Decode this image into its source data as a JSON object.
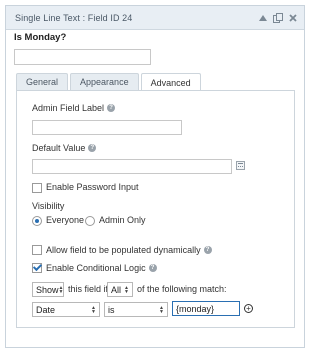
{
  "window": {
    "title": "Single Line Text : Field ID 24",
    "controls": [
      "collapse-up-icon",
      "duplicate-icon",
      "close-icon"
    ]
  },
  "field": {
    "label": "Is Monday?",
    "preview_value": ""
  },
  "tabs": [
    {
      "label": "General",
      "active": false
    },
    {
      "label": "Appearance",
      "active": false
    },
    {
      "label": "Advanced",
      "active": true
    }
  ],
  "advanced": {
    "admin_label": {
      "label": "Admin Field Label",
      "value": ""
    },
    "default_value": {
      "label": "Default Value",
      "value": ""
    },
    "password": {
      "label": "Enable Password Input",
      "checked": false
    },
    "visibility": {
      "label": "Visibility",
      "options": [
        {
          "label": "Everyone",
          "selected": true
        },
        {
          "label": "Admin Only",
          "selected": false
        }
      ]
    },
    "dynamic": {
      "label": "Allow field to be populated dynamically",
      "checked": false
    },
    "conditional": {
      "label": "Enable Conditional Logic",
      "checked": true
    },
    "logic": {
      "action": "Show",
      "text1": "this field if",
      "match": "All",
      "text2": "of the following match:",
      "rule": {
        "field": "Date",
        "operator": "is",
        "value": "{monday}"
      }
    }
  },
  "colors": {
    "accent": "#2a6fb2",
    "titlebar": "#e8eef4",
    "tab_inactive": "#e6ecf1"
  }
}
